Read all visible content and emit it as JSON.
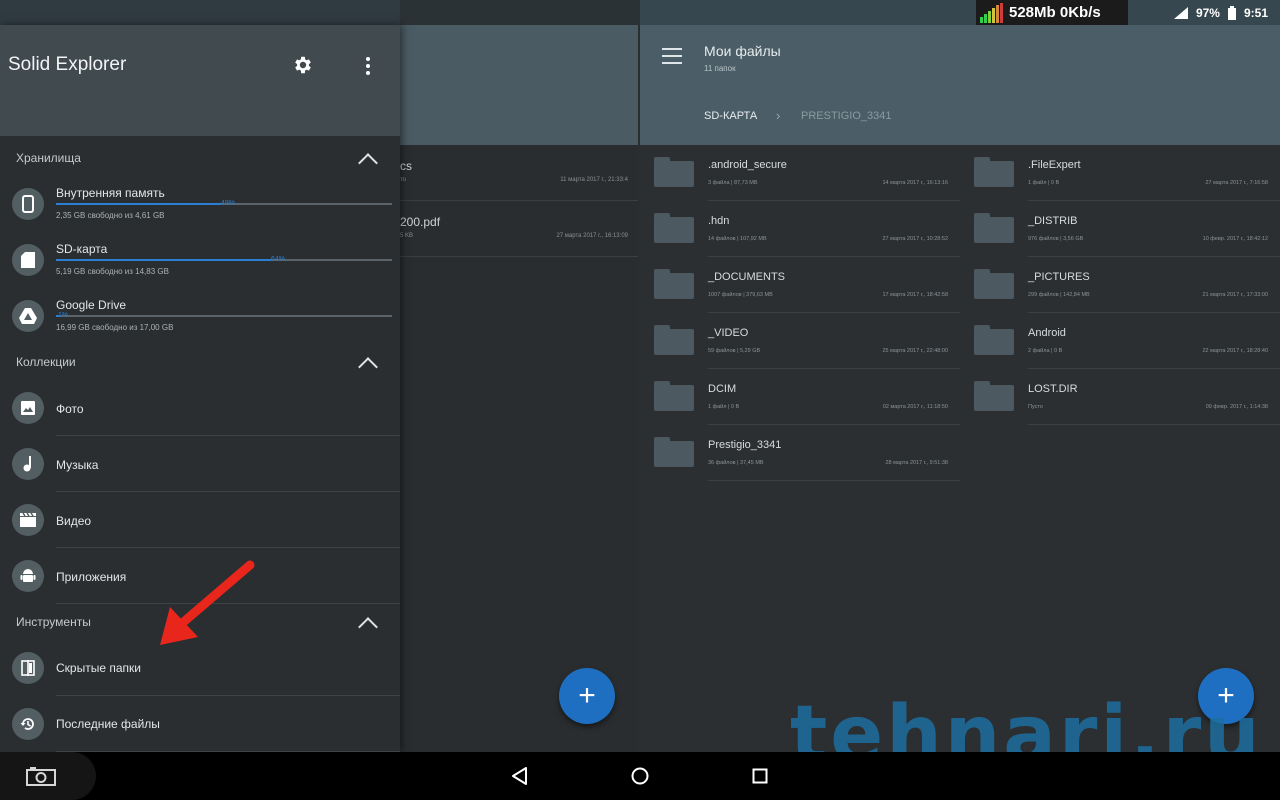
{
  "status_bar": {
    "net_meter": "528Mb 0Kb/s",
    "battery": "97%",
    "time": "9:51"
  },
  "drawer": {
    "app_title": "Solid Explorer",
    "storage_section": "Хранилища",
    "storages": [
      {
        "name": "Внутренняя память",
        "free": "2,35 GB свободно из 4,61 GB",
        "percent_label": "49%",
        "used_fraction": 0.49,
        "icon": "phone-icon"
      },
      {
        "name": "SD-карта",
        "free": "5,19 GB свободно из 14,83 GB",
        "percent_label": "64%",
        "used_fraction": 0.64,
        "icon": "sd-card-icon"
      },
      {
        "name": "Google Drive",
        "free": "16,99 GB свободно из 17,00 GB",
        "percent_label": "1%",
        "used_fraction": 0.01,
        "icon": "google-drive-icon"
      }
    ],
    "collections_section": "Коллекции",
    "collections": [
      {
        "label": "Фото",
        "icon": "photo-icon"
      },
      {
        "label": "Музыка",
        "icon": "music-note-icon"
      },
      {
        "label": "Видео",
        "icon": "clapperboard-icon"
      },
      {
        "label": "Приложения",
        "icon": "android-icon"
      }
    ],
    "tools_section": "Инструменты",
    "tools": [
      {
        "label": "Скрытые папки",
        "icon": "hidden-folder-icon"
      },
      {
        "label": "Последние файлы",
        "icon": "history-icon"
      }
    ]
  },
  "middle_panel": {
    "rows": [
      {
        "name": "cs",
        "meta": "то",
        "date": "11 марта 2017 г., 21:33:4"
      },
      {
        "name": "200.pdf",
        "meta": "5 KB",
        "date": "27 марта 2017 г., 16:13:09"
      }
    ]
  },
  "right_panel": {
    "title": "Мои файлы",
    "subtitle": "11 папок",
    "breadcrumb": [
      "SD-КАРТА",
      "PRESTIGIO_3341"
    ],
    "breadcrumb_sep": "›",
    "folders": [
      {
        "name": ".android_secure",
        "meta": "3 файла | 87,73 MB",
        "date": "14 марта 2017 г., 16:13:16"
      },
      {
        "name": ".FileExpert",
        "meta": "1 файл | 0 B",
        "date": "27 марта 2017 г., 7:16:58"
      },
      {
        "name": ".hdn",
        "meta": "14 файлов | 107,92 MB",
        "date": "27 марта 2017 г., 10:28:52"
      },
      {
        "name": "_DISTRIB",
        "meta": "976 файлов | 3,56 GB",
        "date": "10 февр. 2017 г., 18:42:12"
      },
      {
        "name": "_DOCUMENTS",
        "meta": "1007 файлов | 379,63 MB",
        "date": "17 марта 2017 г., 18:42:58"
      },
      {
        "name": "_PICTURES",
        "meta": "299 файлов | 142,84 MB",
        "date": "21 марта 2017 г., 17:33:00"
      },
      {
        "name": "_VIDEO",
        "meta": "59 файлов | 5,29 GB",
        "date": "25 марта 2017 г., 22:48:00"
      },
      {
        "name": "Android",
        "meta": "2 файла | 0 B",
        "date": "22 марта 2017 г., 18:28:40"
      },
      {
        "name": "DCIM",
        "meta": "1 файл | 0 B",
        "date": "02 марта 2017 г., 11:18:50"
      },
      {
        "name": "LOST.DIR",
        "meta": "Пусто",
        "date": "09 февр. 2017 г., 1:14:38"
      },
      {
        "name": "Prestigio_3341",
        "meta": "36 файлов | 37,45 MB",
        "date": "28 марта 2017 г., 9:51:38"
      }
    ]
  },
  "fab_label": "+",
  "watermark": "tehnari.ru",
  "colors": {
    "accent": "#2a7fd3",
    "fab": "#1e6fc1",
    "drawer_header": "#404a4f",
    "panel_header": "#4b5d66",
    "annotation_arrow": "#e8261c"
  }
}
